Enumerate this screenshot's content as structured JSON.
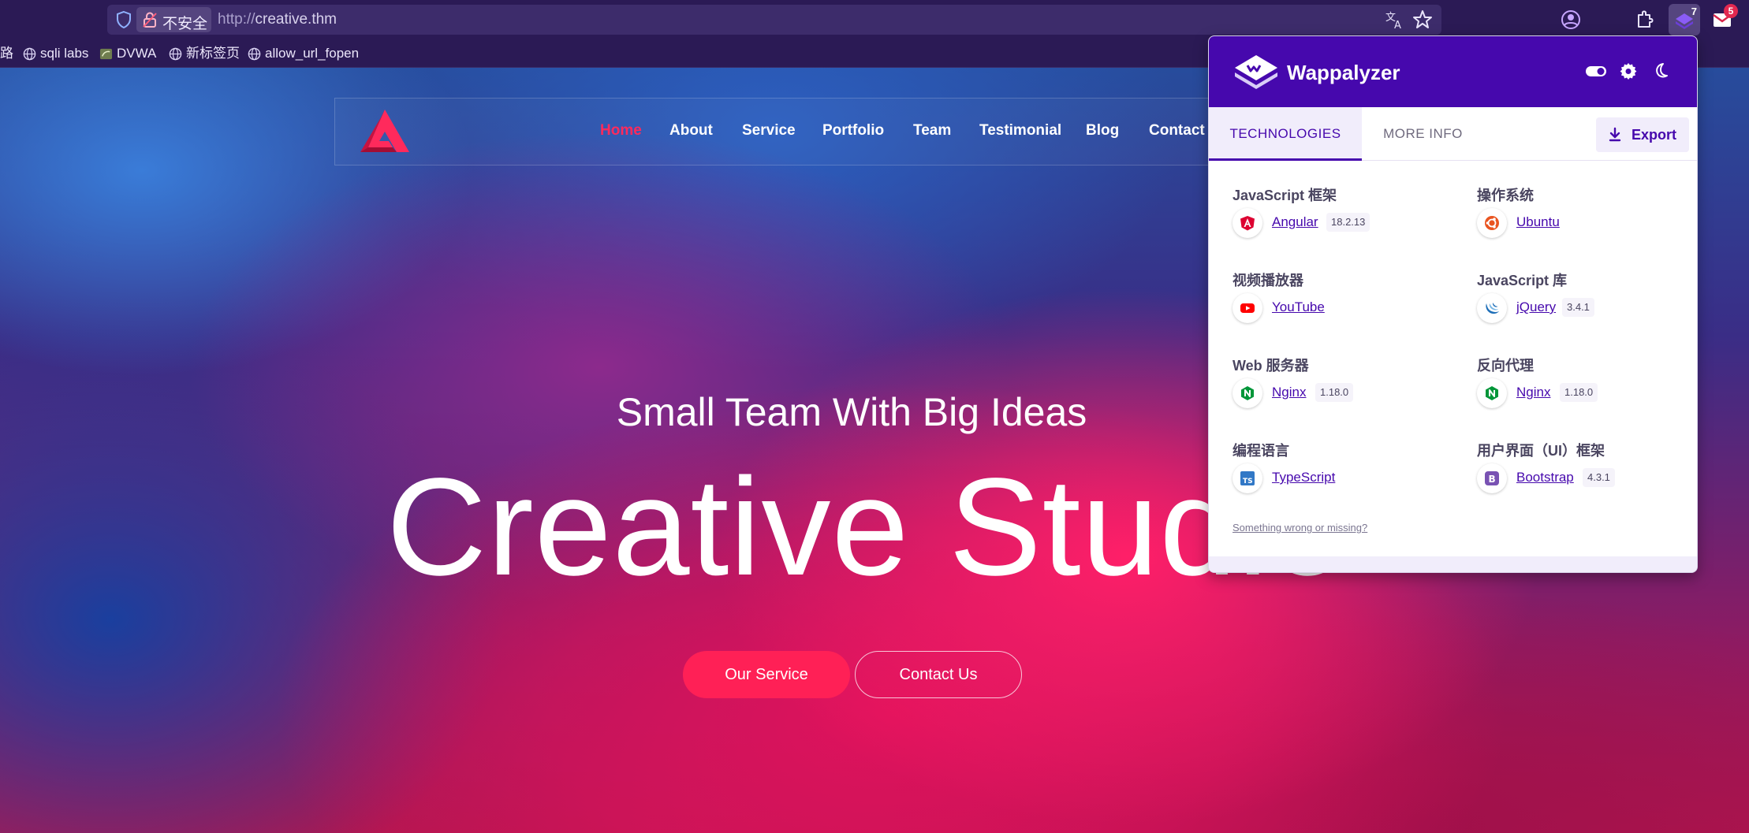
{
  "browser": {
    "security_label": "不安全",
    "url_protocol": "http://",
    "url_host": "creative.thm",
    "wappalyzer_badge": "7",
    "mail_badge": "5"
  },
  "bookmarks": {
    "items": [
      {
        "label": "路"
      },
      {
        "label": "sqli labs"
      },
      {
        "label": "DVWA"
      },
      {
        "label": "新标签页"
      },
      {
        "label": "allow_url_fopen"
      }
    ]
  },
  "site": {
    "nav": [
      "Home",
      "About",
      "Service",
      "Portfolio",
      "Team",
      "Testimonial",
      "Blog",
      "Contact"
    ],
    "hero_subtitle": "Small Team With Big Ideas",
    "hero_title": "Creative Studio",
    "buttons": {
      "primary": "Our Service",
      "secondary": "Contact Us"
    },
    "colors": {
      "accent": "#ff2056"
    }
  },
  "wappalyzer": {
    "name": "Wappalyzer",
    "tabs": {
      "technologies": "TECHNOLOGIES",
      "more_info": "MORE INFO"
    },
    "export_label": "Export",
    "categories": [
      {
        "title": "JavaScript 框架",
        "tech": "Angular",
        "version": "18.2.13",
        "icon": "angular-icon"
      },
      {
        "title": "操作系统",
        "tech": "Ubuntu",
        "version": "",
        "icon": "ubuntu-icon"
      },
      {
        "title": "视频播放器",
        "tech": "YouTube",
        "version": "",
        "icon": "youtube-icon"
      },
      {
        "title": "JavaScript 库",
        "tech": "jQuery",
        "version": "3.4.1",
        "icon": "jquery-icon"
      },
      {
        "title": "Web 服务器",
        "tech": "Nginx",
        "version": "1.18.0",
        "icon": "nginx-icon"
      },
      {
        "title": "反向代理",
        "tech": "Nginx",
        "version": "1.18.0",
        "icon": "nginx-icon"
      },
      {
        "title": "编程语言",
        "tech": "TypeScript",
        "version": "",
        "icon": "typescript-icon"
      },
      {
        "title": "用户界面（UI）框架",
        "tech": "Bootstrap",
        "version": "4.3.1",
        "icon": "bootstrap-icon"
      }
    ],
    "feedback_link": "Something wrong or missing?",
    "colors": {
      "brand": "#4608ad"
    }
  }
}
